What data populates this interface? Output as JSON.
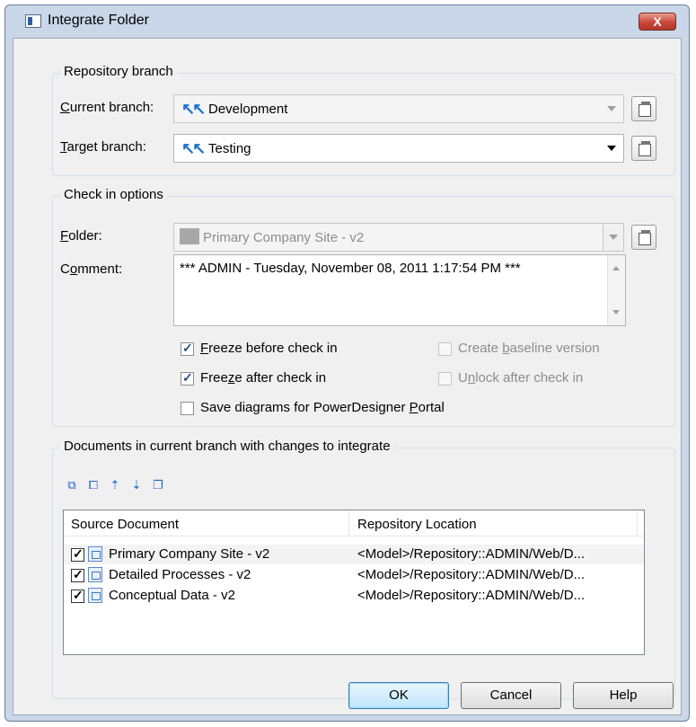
{
  "dialog": {
    "title": "Integrate Folder",
    "close_glyph": "X"
  },
  "repository_branch": {
    "group_label": "Repository branch",
    "current_label_ul": "C",
    "current_label_rest": "urrent branch:",
    "current_value": "Development",
    "target_label_ul": "T",
    "target_label_rest": "arget branch:",
    "target_value": "Testing"
  },
  "check_in": {
    "group_label": "Check in options",
    "folder_label_ul": "F",
    "folder_label_rest": "older:",
    "folder_value": "Primary Company Site - v2",
    "comment_label_pre": "C",
    "comment_label_ul": "o",
    "comment_label_rest": "mment:",
    "comment_value": "*** ADMIN - Tuesday, November 08, 2011 1:17:54 PM ***",
    "options": {
      "freeze_before": {
        "ul": "F",
        "rest": "reeze before check in",
        "checked": true
      },
      "freeze_after": {
        "pre": "Free",
        "ul": "z",
        "rest": "e after check in",
        "checked": true
      },
      "save_diagrams": {
        "pre": "Save diagrams for PowerDesigner ",
        "ul": "P",
        "rest": "ortal",
        "checked": false
      },
      "create_baseline": {
        "pre": "Create ",
        "ul": "b",
        "rest": "aseline version",
        "checked": false
      },
      "unlock_after": {
        "pre": "U",
        "ul": "n",
        "rest": "lock after check in",
        "checked": false
      }
    }
  },
  "documents": {
    "group_label": "Documents in current branch with changes to integrate",
    "toolbar_icons": [
      "select-all-icon",
      "deselect-all-icon",
      "move-up-icon",
      "move-down-icon",
      "properties-icon"
    ],
    "columns": [
      "Source Document",
      "Repository Location"
    ],
    "rows": [
      {
        "name": "Primary Company Site - v2",
        "location": "<Model>/Repository::ADMIN/Web/D...",
        "checked": true
      },
      {
        "name": "Detailed Processes - v2",
        "location": "<Model>/Repository::ADMIN/Web/D...",
        "checked": true
      },
      {
        "name": "Conceptual Data - v2",
        "location": "<Model>/Repository::ADMIN/Web/D...",
        "checked": true
      }
    ]
  },
  "buttons": {
    "ok": "OK",
    "cancel": "Cancel",
    "help": "Help"
  }
}
